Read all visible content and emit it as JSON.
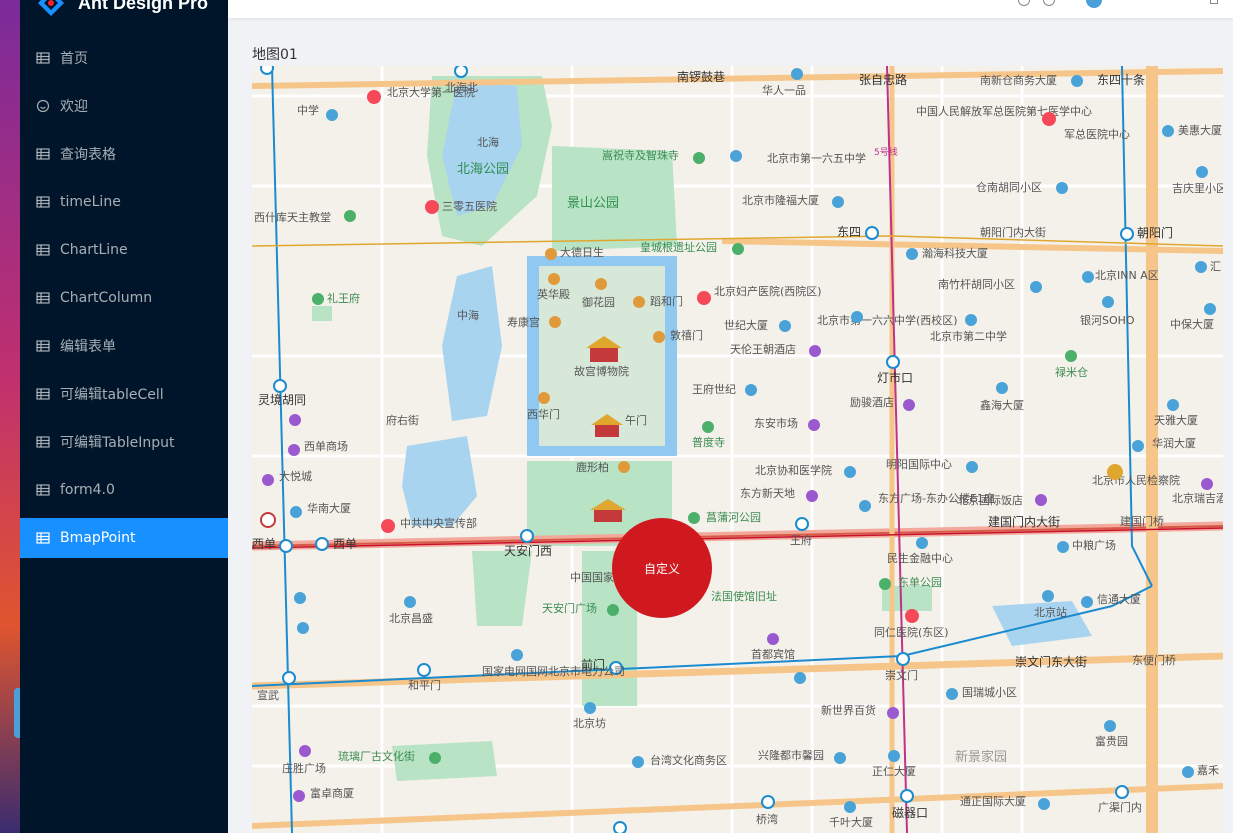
{
  "app": {
    "title": "Ant Design Pro"
  },
  "menu": [
    {
      "label": "首页"
    },
    {
      "label": "欢迎"
    },
    {
      "label": "查询表格"
    },
    {
      "label": "timeLine"
    },
    {
      "label": "ChartLine"
    },
    {
      "label": "ChartColumn"
    },
    {
      "label": "编辑表单"
    },
    {
      "label": "可编辑tableCell"
    },
    {
      "label": "可编辑TableInput"
    },
    {
      "label": "form4.0"
    },
    {
      "label": "BmapPoint"
    }
  ],
  "page": {
    "title": "地图01"
  },
  "marker": {
    "label": "自定义",
    "color": "#d0191e"
  },
  "colors": {
    "sider": "#001529",
    "active": "#1890ff"
  },
  "map": {
    "labels": {
      "l1": "北京大学第一医院",
      "l2": "北海北",
      "l3": "北海",
      "l4": "北海公园",
      "l5": "嵩祝寺及智珠寺",
      "l6": "景山公园",
      "l7": "南锣鼓巷",
      "l8": "华人一品",
      "l9": "张自忠路",
      "l10": "南新仓商务大厦",
      "l11": "东四十条",
      "l12": "中国人民解放军总医院第七医学中心",
      "l13": "军总医院中心",
      "l14": "美惠大厦",
      "l15": "北京市第一六五中学",
      "l16": "5号线",
      "l17": "仓南胡同小区",
      "l18": "吉庆里小区",
      "l19": "北京市隆福大厦",
      "l20": "东四",
      "l21": "朝阳门内大街",
      "l22": "朝阳门",
      "l23": "瀚海科技大厦",
      "l24": "三零五医院",
      "l25": "西什库天主教堂",
      "l26": "中学",
      "l27": "大德日生",
      "l28": "皇城根遗址公园",
      "l29": "礼王府",
      "l30": "英华殿",
      "l31": "御花园",
      "l32": "蹈和门",
      "l33": "北京妇产医院(西院区)",
      "l34": "南竹杆胡同小区",
      "l35": "北京INN A区",
      "l36": "银河SOHO",
      "l37": "中海",
      "l38": "寿康宫",
      "l39": "故宫博物院",
      "l40": "敦禧门",
      "l41": "世纪大厦",
      "l42": "北京市第一六六中学(西校区)",
      "l43": "北京市第二中学",
      "l44": "天伦王朝酒店",
      "l45": "灯市口",
      "l46": "禄米仓",
      "l47": "灵境胡同",
      "l48": "西华门",
      "l49": "午门",
      "l50": "王府世纪",
      "l51": "励骏酒店",
      "l52": "鑫海大厦",
      "l53": "天雅大厦",
      "l54": "府右街",
      "l55": "西单商场",
      "l56": "普度寺",
      "l57": "东安市场",
      "l58": "华润大厦",
      "l59": "大悦城",
      "l60": "鹿形柏",
      "l61": "北京协和医学院",
      "l62": "明阳国际中心",
      "l63": "北京市人民检察院",
      "l64": "华南大厦",
      "l65": "东方新天地",
      "l66": "东方广场-东办公楼E1座",
      "l67": "北京国际饭店",
      "l68": "北京瑞吉酒店",
      "l69": "中共中央宣传部",
      "l70": "菖蒲河公园",
      "l71": "建国门内大街",
      "l72": "建国门桥",
      "l73": "西单",
      "l74": "天安门西",
      "l75": "王府",
      "l76": "民生金融中心",
      "l77": "中粮广场",
      "l78": "中国国家",
      "l79": "东单公园",
      "l80": "北京站",
      "l81": "信通大厦",
      "l82": "北京昌盛",
      "l83": "天安门广场",
      "l84": "法国使馆旧址",
      "l85": "同仁医院(东区)",
      "l86": "首都宾馆",
      "l87": "国家电网国网北京市电力公司",
      "l88": "前门",
      "l89": "崇文门东大街",
      "l90": "东便门桥",
      "l91": "和平门",
      "l92": "宣武",
      "l93": "崇文门",
      "l94": "国瑞城小区",
      "l95": "北京坊",
      "l96": "新世界百货",
      "l97": "富贵园",
      "l98": "庄胜广场",
      "l99": "琉璃厂古文化街",
      "l100": "台湾文化商务区",
      "l101": "兴隆都市馨园",
      "l102": "正仁大厦",
      "l103": "新景家园",
      "l104": "富卓商厦",
      "l105": "桥湾",
      "l106": "千叶大厦",
      "l107": "磁器口",
      "l108": "通正国际大厦",
      "l109": "广渠门内",
      "l110": "嘉禾",
      "l111": "西单",
      "l112": "中保大厦",
      "l113": "汇"
    }
  }
}
